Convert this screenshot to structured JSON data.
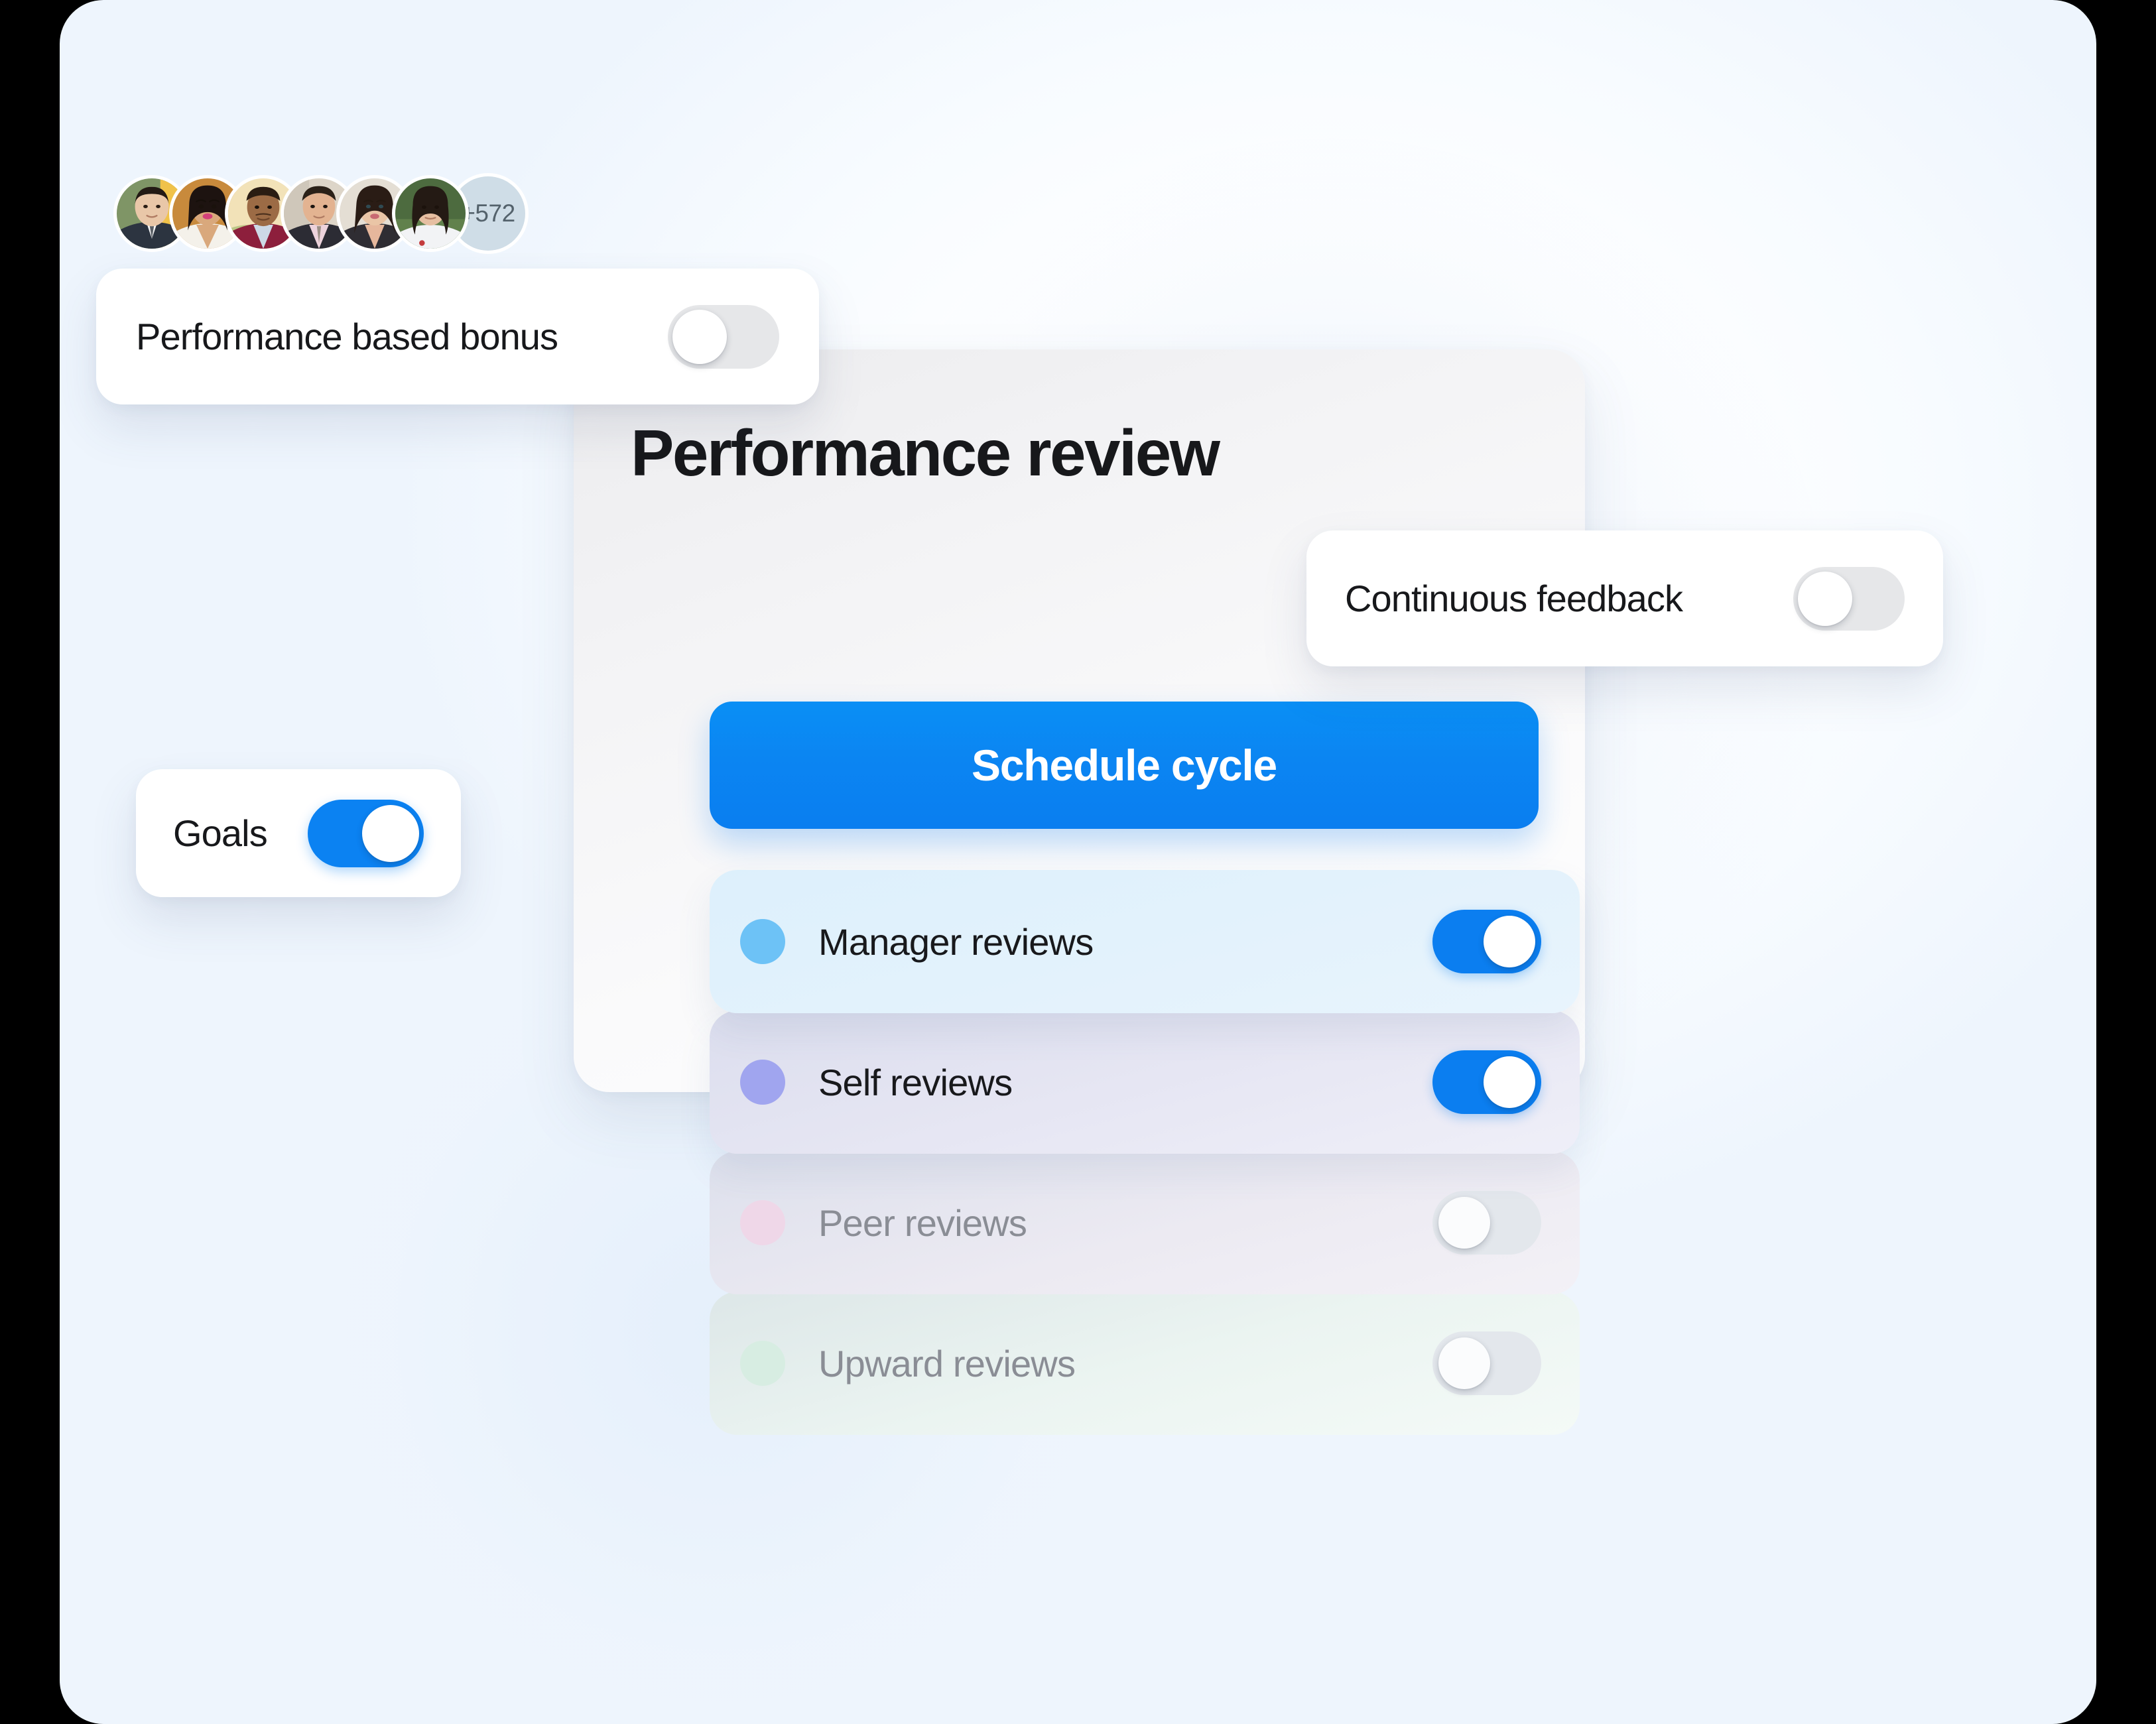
{
  "theme": {
    "accent_blue": "#0b7ef0",
    "cta_gradient_from": "#0a8ff5",
    "cta_gradient_to": "#0a7ef0",
    "toggle_off_track": "#e3e7ec",
    "panel_bg": "#f3f3f5",
    "stage_bg": "#ffffff",
    "page_bg": "#000000"
  },
  "panel": {
    "title": "Performance review",
    "cta_label": "Schedule cycle",
    "avatars": {
      "count_visible": 6,
      "overflow_label": "+572",
      "people": [
        {
          "name": "avatar-person-1",
          "skin": "#e9c7a8",
          "hair": "#231a14",
          "shirt": "#2c3440",
          "bg": "#7f9566",
          "accent": "#f0c24a"
        },
        {
          "name": "avatar-person-2",
          "skin": "#d9a87c",
          "hair": "#1d1310",
          "shirt": "#f4f1ea",
          "bg": "#c88a3c",
          "accent": "#d3407a"
        },
        {
          "name": "avatar-person-3",
          "skin": "#9c6b45",
          "hair": "#2a1c12",
          "shirt": "#8d1f3c",
          "bg": "#f2e2b8",
          "accent": "#cdd9e6"
        },
        {
          "name": "avatar-person-4",
          "skin": "#e3b391",
          "hair": "#2b2118",
          "shirt": "#edd3dc",
          "bg": "#ddd5c8",
          "accent": "#2c2c34"
        },
        {
          "name": "avatar-person-5",
          "skin": "#eac5a6",
          "hair": "#2a1c15",
          "shirt": "#2f2d33",
          "bg": "#e4ded4",
          "accent": "#c96a72"
        },
        {
          "name": "avatar-person-6",
          "skin": "#e6bfa2",
          "hair": "#241a14",
          "shirt": "#f2f3f5",
          "bg": "#4d6b3f",
          "accent": "#c43c3c"
        }
      ]
    },
    "options": [
      {
        "label": "Manager reviews",
        "dot_color": "#6dc2f6",
        "enabled": true,
        "state_text": "on"
      },
      {
        "label": "Self reviews",
        "dot_color": "#a0a5ef",
        "enabled": true,
        "state_text": "on"
      },
      {
        "label": "Peer reviews",
        "dot_color": "#efd7e8",
        "enabled": false,
        "state_text": "off"
      },
      {
        "label": "Upward reviews",
        "dot_color": "#d7ede2",
        "enabled": false,
        "state_text": "off"
      }
    ]
  },
  "floating_cards": [
    {
      "id": "bonus",
      "label": "Performance based bonus",
      "enabled": false,
      "state_text": "off"
    },
    {
      "id": "feedback",
      "label": "Continuous feedback",
      "enabled": false,
      "state_text": "off"
    },
    {
      "id": "goals",
      "label": "Goals",
      "enabled": true,
      "state_text": "on"
    }
  ]
}
